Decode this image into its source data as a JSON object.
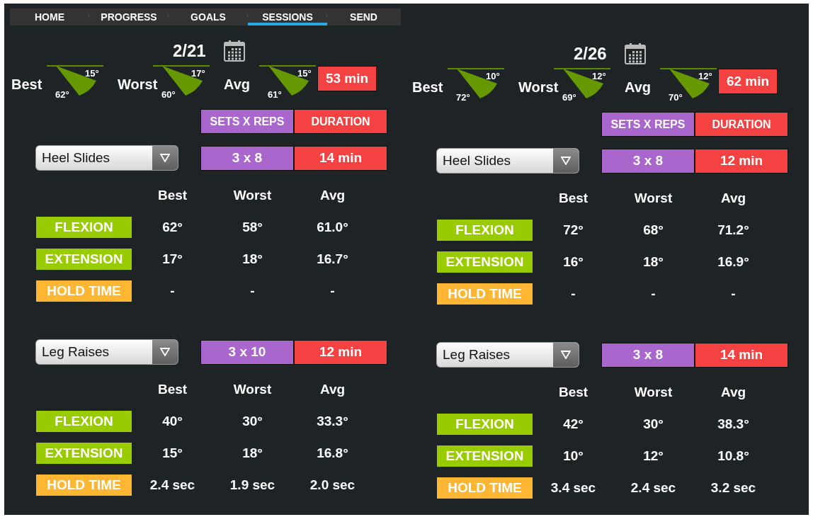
{
  "tabs": [
    {
      "label": "HOME",
      "selected": false
    },
    {
      "label": "PROGRESS",
      "selected": false
    },
    {
      "label": "GOALS",
      "selected": false
    },
    {
      "label": "SESSIONS",
      "selected": true
    },
    {
      "label": "SEND",
      "selected": false
    }
  ],
  "sessions": [
    {
      "date": "2/21",
      "gauges": [
        {
          "label": "Best",
          "extension": "15°",
          "flexion": "62°"
        },
        {
          "label": "Worst",
          "extension": "17°",
          "flexion": "60°"
        },
        {
          "label": "Avg",
          "extension": "15°",
          "flexion": "61°"
        }
      ],
      "total": "53 min",
      "sets_reps_header": "SETS X REPS",
      "duration_header": "DURATION",
      "exercises": [
        {
          "name": "Heel Slides",
          "sets_reps": "3 x 8",
          "duration": "14 min",
          "headers": [
            "Best",
            "Worst",
            "Avg"
          ],
          "rows": [
            {
              "label": "FLEXION",
              "kind": "angle",
              "values": [
                "62°",
                "58°",
                "61.0°"
              ]
            },
            {
              "label": "EXTENSION",
              "kind": "angle",
              "values": [
                "17°",
                "18°",
                "16.7°"
              ]
            },
            {
              "label": "HOLD TIME",
              "kind": "hold",
              "values": [
                "-",
                "-",
                "-"
              ]
            }
          ]
        },
        {
          "name": "Leg Raises",
          "sets_reps": "3 x 10",
          "duration": "12 min",
          "headers": [
            "Best",
            "Worst",
            "Avg"
          ],
          "rows": [
            {
              "label": "FLEXION",
              "kind": "angle",
              "values": [
                "40°",
                "30°",
                "33.3°"
              ]
            },
            {
              "label": "EXTENSION",
              "kind": "angle",
              "values": [
                "15°",
                "18°",
                "16.8°"
              ]
            },
            {
              "label": "HOLD TIME",
              "kind": "hold",
              "values": [
                "2.4 sec",
                "1.9 sec",
                "2.0 sec"
              ]
            }
          ]
        }
      ]
    },
    {
      "date": "2/26",
      "gauges": [
        {
          "label": "Best",
          "extension": "10°",
          "flexion": "72°"
        },
        {
          "label": "Worst",
          "extension": "12°",
          "flexion": "69°"
        },
        {
          "label": "Avg",
          "extension": "12°",
          "flexion": "70°"
        }
      ],
      "total": "62 min",
      "sets_reps_header": "SETS X REPS",
      "duration_header": "DURATION",
      "exercises": [
        {
          "name": "Heel Slides",
          "sets_reps": "3 x 8",
          "duration": "12 min",
          "headers": [
            "Best",
            "Worst",
            "Avg"
          ],
          "rows": [
            {
              "label": "FLEXION",
              "kind": "angle",
              "values": [
                "72°",
                "68°",
                "71.2°"
              ]
            },
            {
              "label": "EXTENSION",
              "kind": "angle",
              "values": [
                "16°",
                "18°",
                "16.9°"
              ]
            },
            {
              "label": "HOLD TIME",
              "kind": "hold",
              "values": [
                "-",
                "-",
                "-"
              ]
            }
          ]
        },
        {
          "name": "Leg Raises",
          "sets_reps": "3 x 8",
          "duration": "14 min",
          "headers": [
            "Best",
            "Worst",
            "Avg"
          ],
          "rows": [
            {
              "label": "FLEXION",
              "kind": "angle",
              "values": [
                "42°",
                "30°",
                "38.3°"
              ]
            },
            {
              "label": "EXTENSION",
              "kind": "angle",
              "values": [
                "10°",
                "12°",
                "10.8°"
              ]
            },
            {
              "label": "HOLD TIME",
              "kind": "hold",
              "values": [
                "3.4 sec",
                "2.4 sec",
                "3.2 sec"
              ]
            }
          ]
        }
      ]
    }
  ]
}
